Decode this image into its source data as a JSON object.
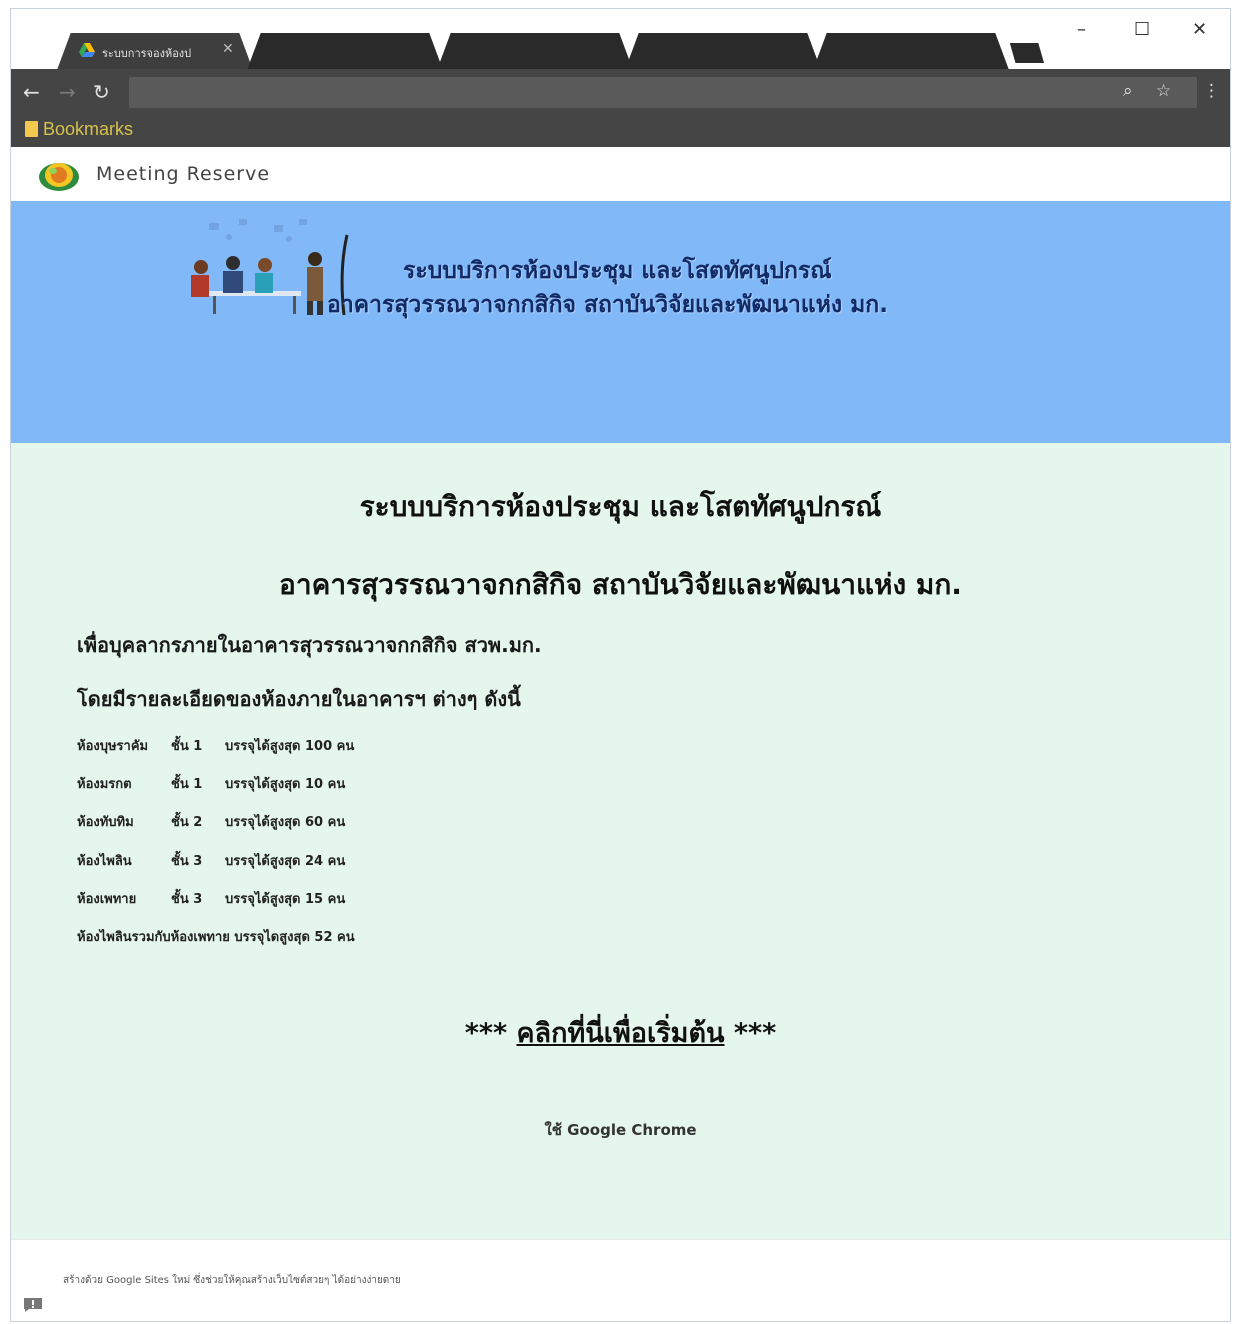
{
  "browser": {
    "active_tab_title": "ระบบการจองห้องป",
    "bookmarks_label": "Bookmarks",
    "window_controls": {
      "minimize": "–",
      "maximize": "☐",
      "close": "✕"
    },
    "nav": {
      "back": "←",
      "forward": "→",
      "reload": "↻"
    },
    "omnibox_icons": {
      "zoom": "⌕",
      "star": "☆",
      "menu": "⋮"
    }
  },
  "site": {
    "name": "Meeting Reserve"
  },
  "banner": {
    "line1": "ระบบบริการห้องประชุม และโสตทัศนูปกรณ์",
    "line2": "อาคารสุวรรณวาจกกสิกิจ สถาบันวิจัยและพัฒนาแห่ง มก."
  },
  "main": {
    "title1": "ระบบบริการห้องประชุม และโสตทัศนูปกรณ์",
    "title2": "อาคารสุวรรณวาจกกสิกิจ สถาบันวิจัยและพัฒนาแห่ง มก.",
    "intro1": "เพื่อบุคลากรภายในอาคารสุวรรณวาจกกสิกิจ สวพ.มก.",
    "intro2": "โดยมีรายละเอียดของห้องภายในอาคารฯ ต่างๆ ดังนี้",
    "rooms": [
      {
        "name": "ห้องบุษราคัม",
        "floor": "ชั้น 1",
        "capacity": "บรรจุได้สูงสุด 100 คน"
      },
      {
        "name": "ห้องมรกต",
        "floor": "ชั้น 1",
        "capacity": "บรรจุได้สูงสุด 10 คน"
      },
      {
        "name": "ห้องทับทิม",
        "floor": "ชั้น 2",
        "capacity": "บรรจุได้สูงสุด 60 คน"
      },
      {
        "name": "ห้องไพลิน",
        "floor": "ชั้น 3",
        "capacity": "บรรจุได้สูงสุด 24 คน"
      },
      {
        "name": "ห้องเพทาย",
        "floor": "ชั้น 3",
        "capacity": "บรรจุได้สูงสุด 15 คน"
      }
    ],
    "combined_room": "ห้องไพลินรวมกับห้องเพทาย บรรจุไดสูงสุด 52 คน",
    "cta_prefix": "***",
    "cta_link": "คลิกที่นี่เพื่อเริ่มต้น",
    "cta_suffix": "***",
    "browser_note": "ใช้ Google Chrome"
  },
  "footer": {
    "text": "สร้างด้วย Google Sites ใหม่ ซึ่งช่วยให้คุณสร้างเว็บไซต์สวยๆ ได้อย่างง่ายดาย"
  },
  "colors": {
    "banner_bg": "#80b8f8",
    "main_bg": "#e5f6ec",
    "toolbar_bg": "#454545",
    "banner_text": "#122a66"
  }
}
